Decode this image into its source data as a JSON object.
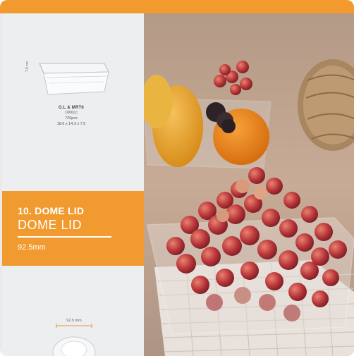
{
  "product": {
    "name": "G.L & MRT6",
    "capacity": "1000cc",
    "pieces": "720pcs",
    "size": "18.6 x 14.3 x 7.5",
    "height_label": "7.5 cm"
  },
  "section": {
    "title": "10. DOME LID",
    "subtitle": "DOME LID",
    "size": "92.5mm"
  },
  "lid": {
    "dimension_label": "92.5 mm"
  },
  "colors": {
    "accent": "#f19a30",
    "panel": "#eceeef"
  }
}
